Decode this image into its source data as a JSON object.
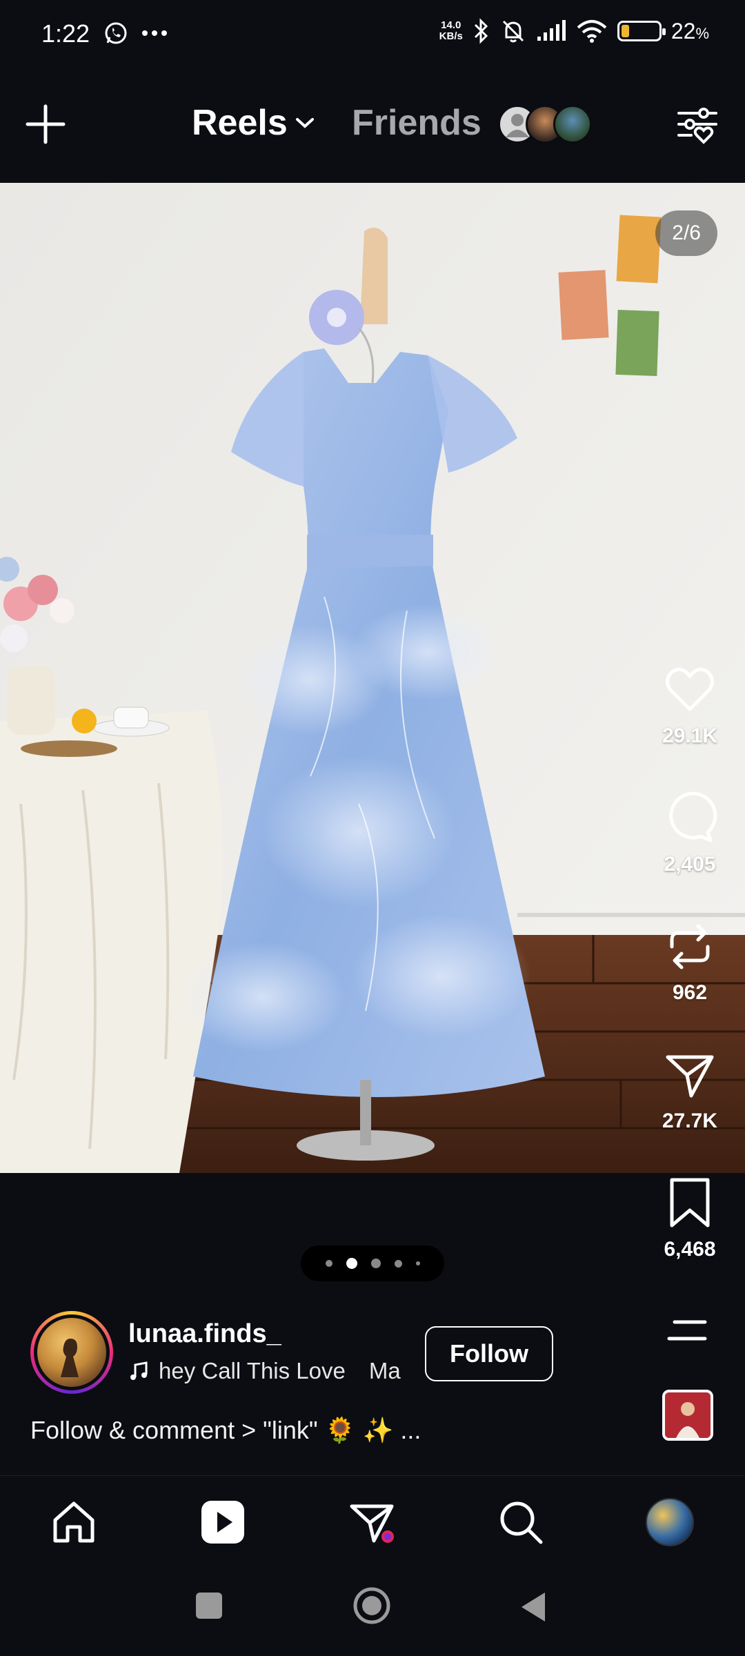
{
  "status_bar": {
    "time": "1:22",
    "net_speed_value": "14.0",
    "net_speed_unit": "KB/s",
    "battery_percent": "22",
    "battery_symbol": "%",
    "battery_level": 0.22,
    "icons": [
      "whatsapp-icon",
      "more-dots-icon",
      "bluetooth-icon",
      "bell-muted-icon",
      "signal-icon",
      "wifi-icon",
      "battery-icon"
    ]
  },
  "header": {
    "create_icon": "plus-icon",
    "reels_label": "Reels",
    "friends_label": "Friends",
    "filter_icon": "heart-sliders-icon"
  },
  "media": {
    "counter": "2/6"
  },
  "actions": {
    "like_count": "29.1K",
    "comment_count": "2,405",
    "repost_count": "962",
    "share_count": "27.7K",
    "save_count": "6,468"
  },
  "pager": {
    "active_index": 1
  },
  "post": {
    "username": "lunaa.finds_",
    "music_title": "hey Call This Love",
    "music_artist_snippet": "Ma",
    "follow_label": "Follow",
    "caption": "Follow & comment > \"link\" 🌻 ✨ ..."
  },
  "bottom_nav": {
    "items": [
      "home-icon",
      "reels-icon",
      "direct-messages-icon",
      "search-icon",
      "profile-avatar"
    ]
  },
  "colors": {
    "background": "#0b0d12",
    "notification_dot": "#e0245e",
    "battery_fill": "#f2b531"
  }
}
